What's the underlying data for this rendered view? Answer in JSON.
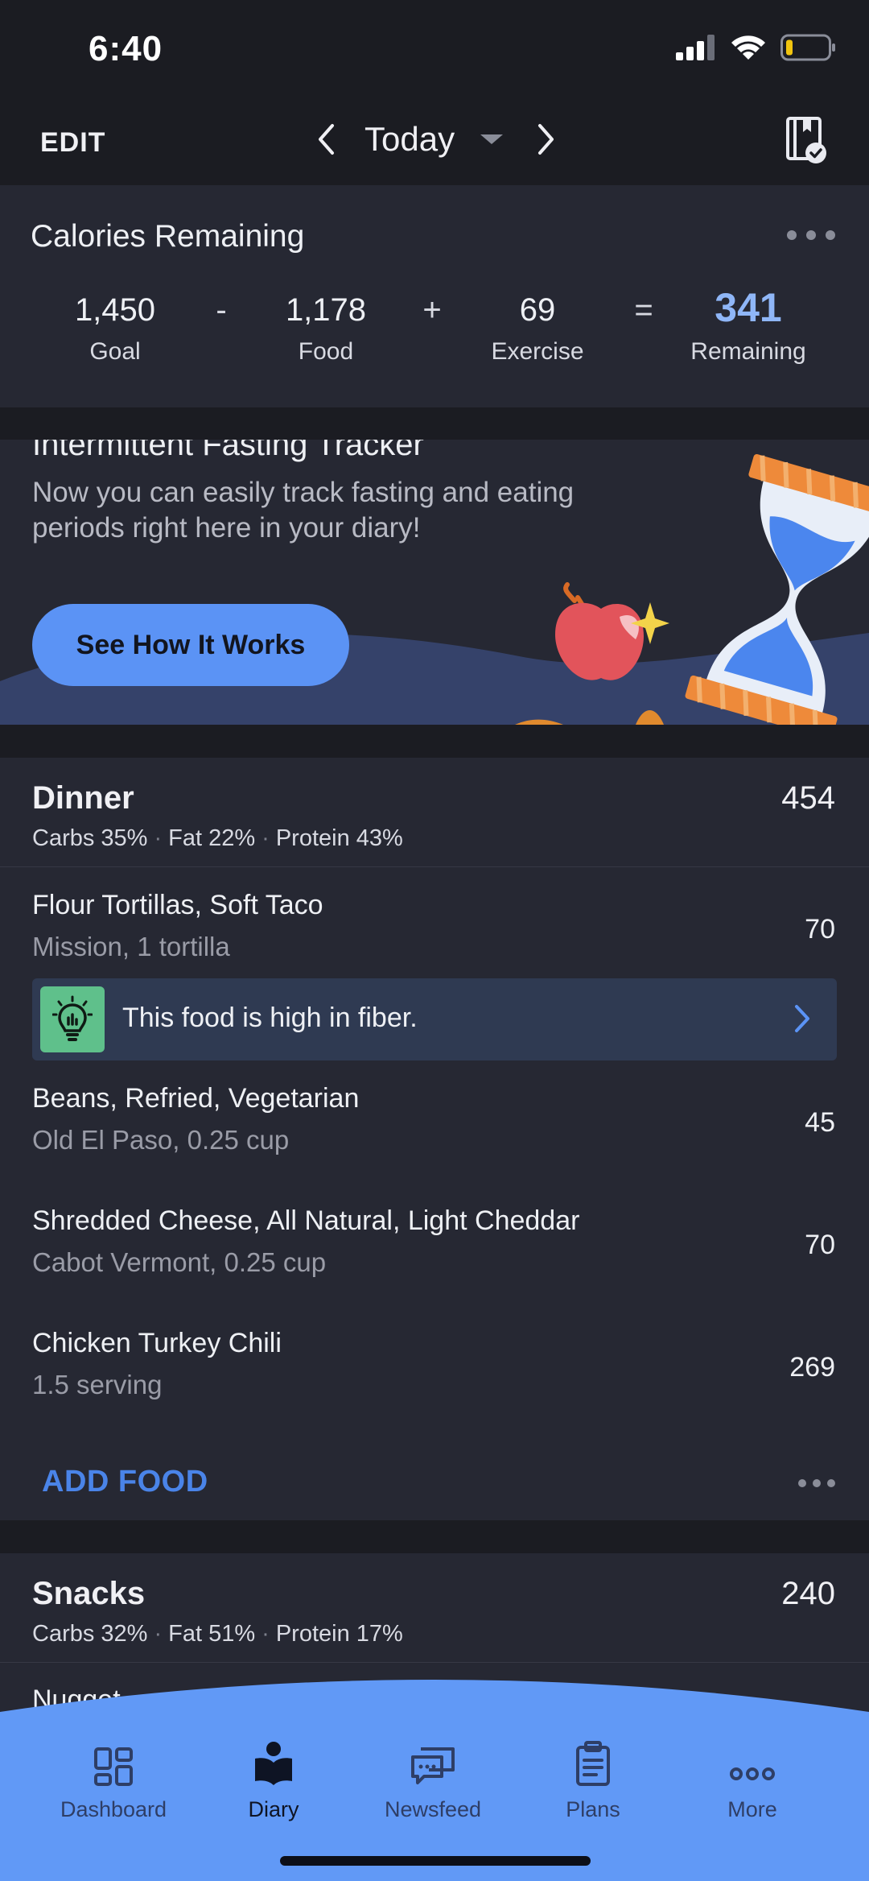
{
  "status_bar": {
    "time": "6:40"
  },
  "header": {
    "edit_label": "EDIT",
    "date_label": "Today"
  },
  "calories": {
    "title": "Calories Remaining",
    "goal_value": "1,450",
    "goal_label": "Goal",
    "food_value": "1,178",
    "food_label": "Food",
    "exercise_value": "69",
    "exercise_label": "Exercise",
    "remaining_value": "341",
    "remaining_label": "Remaining",
    "op_minus": "-",
    "op_plus": "+",
    "op_equals": "="
  },
  "promo": {
    "title": "Intermittent Fasting Tracker",
    "text": "Now you can easily track fasting and eating periods right here in your diary!",
    "button_label": "See How It Works"
  },
  "dinner": {
    "name": "Dinner",
    "total": "454",
    "macros": {
      "carbs": "Carbs 35%",
      "fat": "Fat 22%",
      "protein": "Protein 43%"
    },
    "items": [
      {
        "name": "Flour Tortillas, Soft Taco",
        "detail": "Mission, 1 tortilla",
        "calories": "70"
      },
      {
        "name": "Beans, Refried, Vegetarian",
        "detail": "Old El Paso, 0.25 cup",
        "calories": "45"
      },
      {
        "name": "Shredded Cheese, All Natural, Light Cheddar",
        "detail": "Cabot Vermont, 0.25 cup",
        "calories": "70"
      },
      {
        "name": "Chicken Turkey Chili",
        "detail": "1.5 serving",
        "calories": "269"
      }
    ],
    "tip": "This food is high in fiber.",
    "add_food_label": "ADD FOOD"
  },
  "snacks": {
    "name": "Snacks",
    "total": "240",
    "macros": {
      "carbs": "Carbs 32%",
      "fat": "Fat 51%",
      "protein": "Protein 17%"
    },
    "peek_item": "Nugget"
  },
  "tabs": [
    {
      "label": "Dashboard",
      "icon": "dashboard-icon"
    },
    {
      "label": "Diary",
      "icon": "diary-icon"
    },
    {
      "label": "Newsfeed",
      "icon": "newsfeed-icon"
    },
    {
      "label": "Plans",
      "icon": "plans-icon"
    },
    {
      "label": "More",
      "icon": "more-icon"
    }
  ],
  "colors": {
    "background": "#1b1c22",
    "card": "#262833",
    "accent": "#5b93f5",
    "remaining": "#8fb6f7",
    "tip_bg": "#2f3a52",
    "tip_icon": "#5fc08b"
  }
}
